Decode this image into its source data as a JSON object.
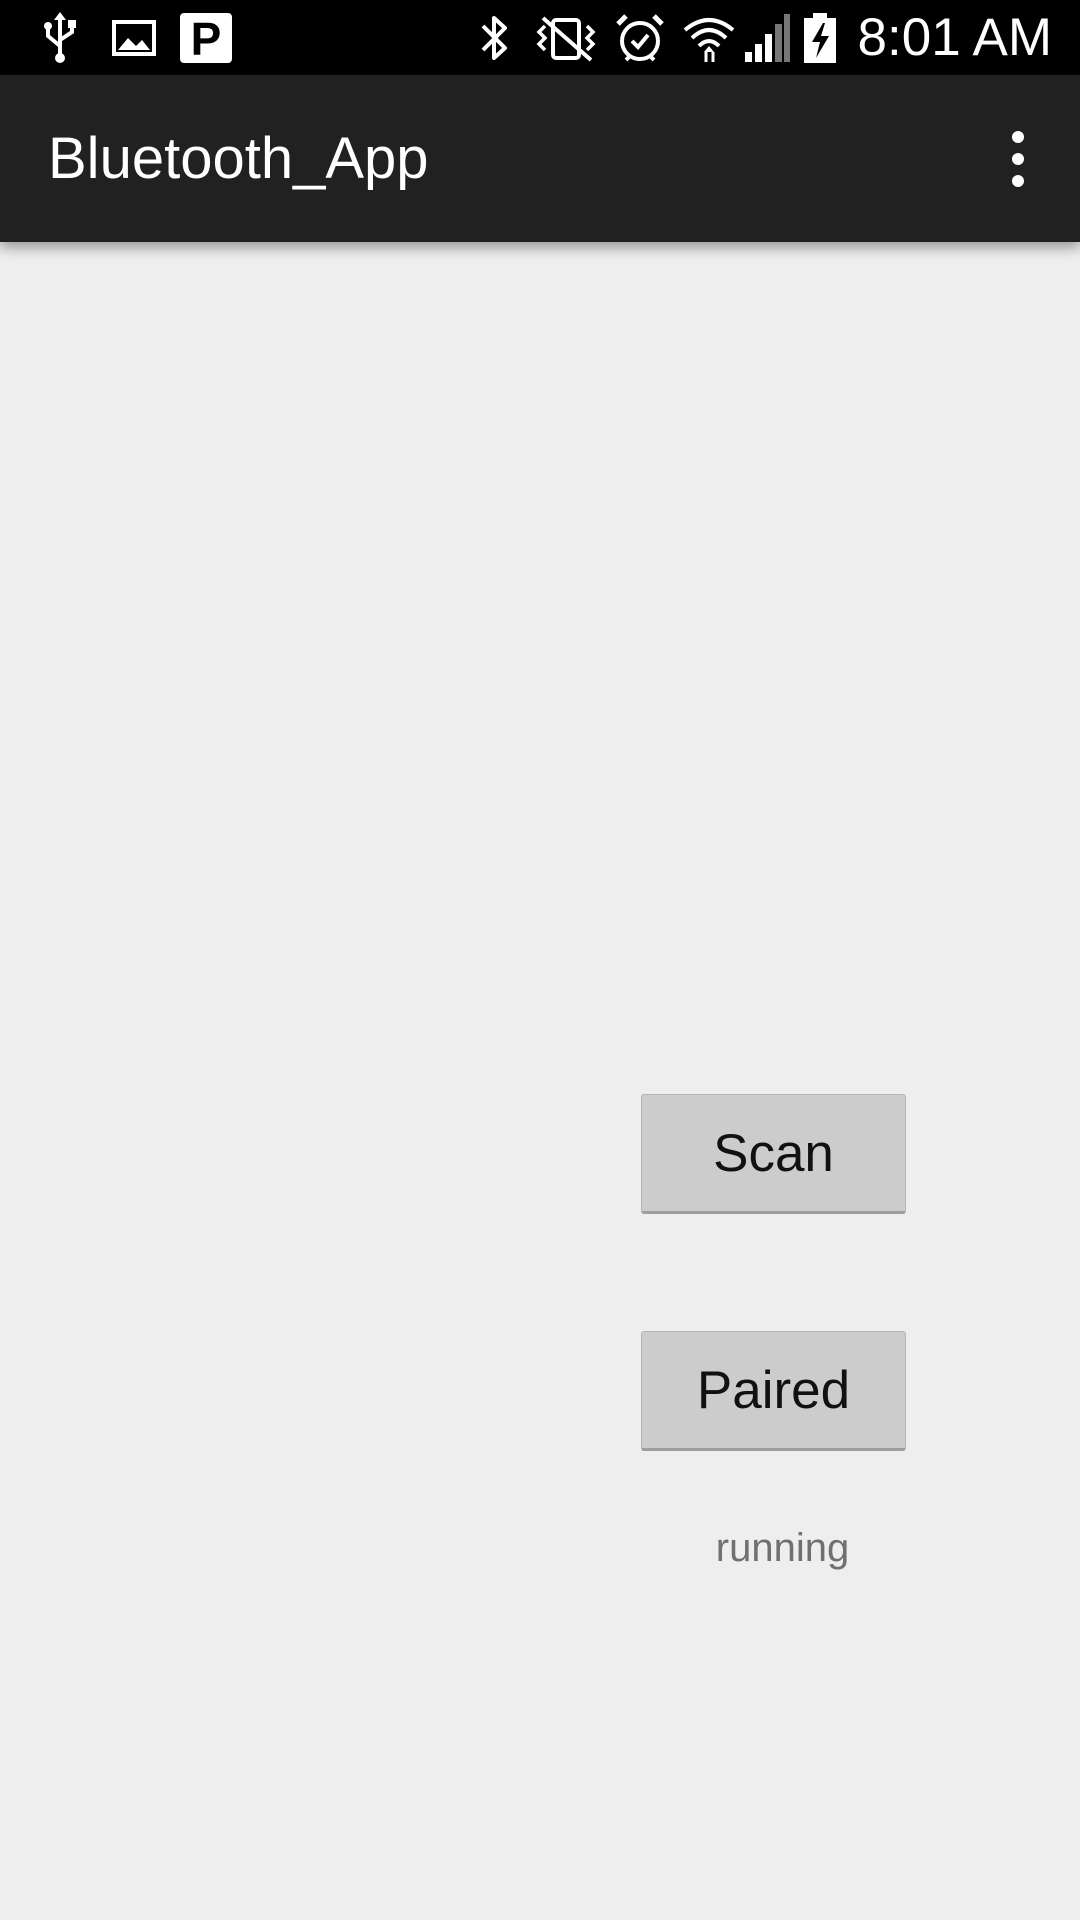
{
  "status_bar": {
    "time": "8:01 AM",
    "left_icons": [
      "usb-icon",
      "image-icon",
      "parking-icon"
    ],
    "right_icons": [
      "bluetooth-icon",
      "vibrate-icon",
      "alarm-icon",
      "wifi-icon",
      "signal-icon",
      "battery-charging-icon"
    ],
    "parking_letter": "P"
  },
  "action_bar": {
    "title": "Bluetooth_App",
    "overflow_icon": "more-vert-icon"
  },
  "main": {
    "scan_button_label": "Scan",
    "paired_button_label": "Paired",
    "status_text": "running"
  },
  "colors": {
    "status_bar_bg": "#000000",
    "action_bar_bg": "#212121",
    "content_bg": "#eeeeee",
    "button_bg": "#cccccc"
  }
}
